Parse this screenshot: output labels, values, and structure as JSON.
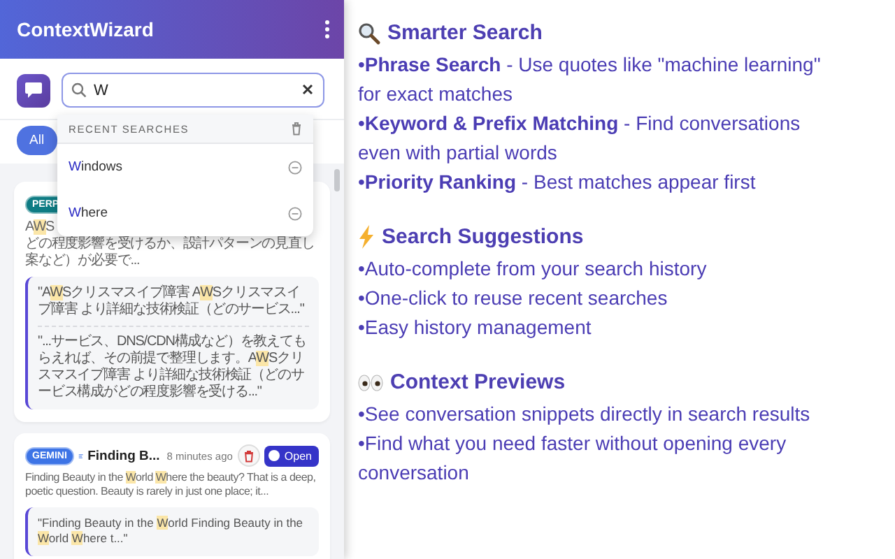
{
  "sidebar": {
    "title": "ContextWizard",
    "search": {
      "value": "W"
    },
    "recent_searches": {
      "header": "RECENT SEARCHES",
      "items": [
        {
          "text": "**W**indows"
        },
        {
          "text": "**W**here"
        }
      ]
    },
    "filters": [
      {
        "label": "All",
        "selected": true
      }
    ],
    "conversations": [
      {
        "source": "PERP",
        "color": "#0f7c84",
        "summary": [
          "A**W**S",
          "どの程度影響を受けるか、設計パターンの見直し案など）が必要で..."
        ],
        "snippets": [
          "\"A**W**Sクリスマスイブ障害 A**W**Sクリスマスイブ障害 より詳細な技術検証（どのサービス...\"",
          "\"...サービス、DNS/CDN構成など）を教えてもらえれば、その前提で整理します。A**W**Sクリスマスイブ障害 より詳細な技術検証（どのサービス構成がどの程度影響を受ける...\""
        ]
      },
      {
        "source": "GEMINI",
        "color": "#3d74e6",
        "title": "Finding B...",
        "time": "8 minutes ago",
        "open_label": "Open",
        "summary": [
          "Finding Beauty in the **W**orld **W**here the beauty? That is a deep, poetic question. Beauty is rarely in just one place; it..."
        ],
        "snippets": [
          "\"Finding Beauty in the **W**orld Finding Beauty in the **W**orld **W**here t...\""
        ]
      }
    ]
  },
  "features": [
    {
      "kind": "search",
      "heading": "Smarter Search",
      "bullets": [
        "•**Phrase Search** - Use quotes like \"machine learning\" for exact matches",
        "•**Keyword & Prefix Matching** - Find conversations even with partial words",
        "•**Priority Ranking** - Best matches appear first"
      ]
    },
    {
      "kind": "bolt",
      "heading": "Search Suggestions",
      "bullets": [
        "•Auto-complete from your search history",
        "•One-click to reuse recent searches",
        "•Easy history management"
      ]
    },
    {
      "kind": "eyes",
      "heading": "Context Previews",
      "bullets": [
        "•See conversation snippets directly in search results",
        "•Find what you need faster without opening every conversation"
      ]
    }
  ]
}
